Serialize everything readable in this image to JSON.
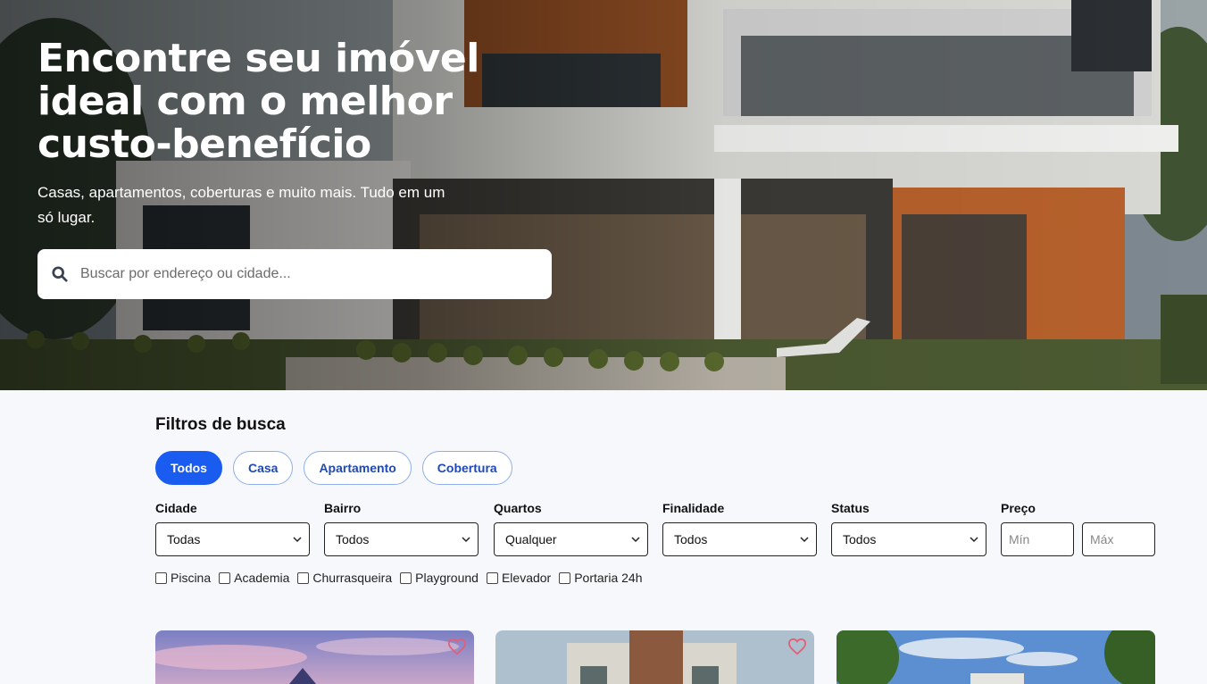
{
  "hero": {
    "title_line1": "Encontre seu imóvel",
    "title_line2": "ideal com o melhor",
    "title_line3": "custo-benefício",
    "subtitle": "Casas, apartamentos, coberturas e muito mais. Tudo em um só lugar.",
    "search_placeholder": "Buscar por endereço ou cidade..."
  },
  "filters": {
    "title": "Filtros de busca",
    "chips": [
      {
        "label": "Todos",
        "active": true
      },
      {
        "label": "Casa",
        "active": false
      },
      {
        "label": "Apartamento",
        "active": false
      },
      {
        "label": "Cobertura",
        "active": false
      }
    ],
    "fields": {
      "cidade": {
        "label": "Cidade",
        "value": "Todas"
      },
      "bairro": {
        "label": "Bairro",
        "value": "Todos"
      },
      "quartos": {
        "label": "Quartos",
        "value": "Qualquer"
      },
      "finalidade": {
        "label": "Finalidade",
        "value": "Todos"
      },
      "status": {
        "label": "Status",
        "value": "Todos"
      },
      "preco": {
        "label": "Preço",
        "min_placeholder": "Mín",
        "max_placeholder": "Máx"
      }
    },
    "amenities": [
      "Piscina",
      "Academia",
      "Churrasqueira",
      "Playground",
      "Elevador",
      "Portaria 24h"
    ]
  },
  "colors": {
    "primary": "#1a5cf0",
    "chip_text": "#1f49b6",
    "heart": "#e0607a"
  },
  "icons": {
    "search": "search-icon",
    "select": "chevron-down-icon",
    "favorite": "heart-icon"
  }
}
